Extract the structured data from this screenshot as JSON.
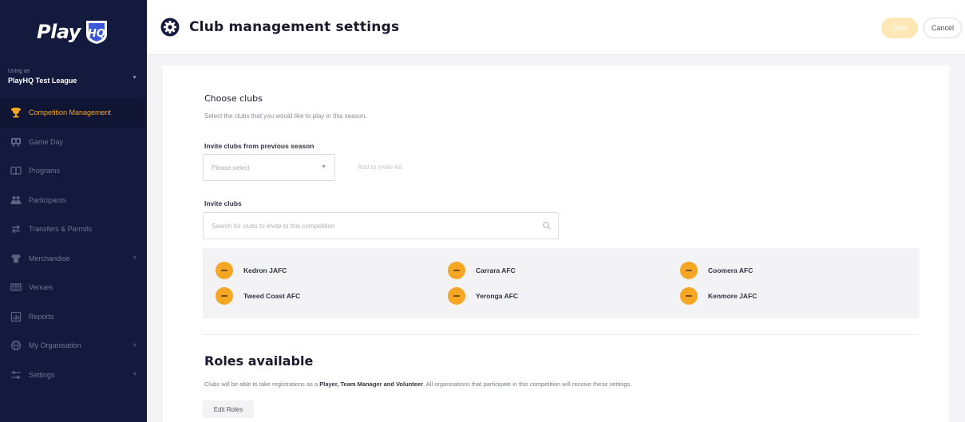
{
  "app": {
    "logo_text": "Play",
    "logo_mark": "HQ"
  },
  "org": {
    "label": "Using as",
    "name": "PlayHQ Test League"
  },
  "sidebar": {
    "items": [
      {
        "label": "Competition Management",
        "icon": "trophy-icon",
        "active": true
      },
      {
        "label": "Game Day",
        "icon": "scoreboard-icon"
      },
      {
        "label": "Programs",
        "icon": "book-icon"
      },
      {
        "label": "Participants",
        "icon": "people-icon"
      },
      {
        "label": "Transfers & Permits",
        "icon": "transfer-icon"
      },
      {
        "label": "Merchandise",
        "icon": "shirt-icon",
        "expandable": true
      },
      {
        "label": "Venues",
        "icon": "stadium-icon"
      },
      {
        "label": "Reports",
        "icon": "report-icon"
      },
      {
        "label": "My Organisation",
        "icon": "globe-icon",
        "expandable": true
      },
      {
        "label": "Settings",
        "icon": "sliders-icon",
        "expandable": true
      }
    ],
    "expand_glyph": "+"
  },
  "header": {
    "title": "Club management settings",
    "save_label": "Save",
    "cancel_label": "Cancel"
  },
  "choose_clubs": {
    "title": "Choose clubs",
    "description": "Select the clubs that you would like to play in this season.",
    "previous_label": "Invite clubs from previous season",
    "previous_placeholder": "Please select",
    "add_button": "Add to invite list",
    "invite_label": "Invite clubs",
    "search_placeholder": "Search for clubs to invite to this competition"
  },
  "clubs": [
    {
      "name": "Kedron JAFC"
    },
    {
      "name": "Carrara AFC"
    },
    {
      "name": "Coomera AFC"
    },
    {
      "name": "Tweed Coast AFC"
    },
    {
      "name": "Yeronga AFC"
    },
    {
      "name": "Kenmore JAFC"
    }
  ],
  "roles": {
    "title": "Roles available",
    "desc_prefix": "Clubs will be able to take registrations as a ",
    "desc_roles": "Player, Team Manager and Volunteer",
    "desc_suffix": ". All organisations that participate in this competition will receive these settings.",
    "edit_button": "Edit Roles"
  },
  "colors": {
    "sidebar_bg": "#141a3d",
    "accent": "#f5a623",
    "page_bg": "#f4f4f6"
  }
}
